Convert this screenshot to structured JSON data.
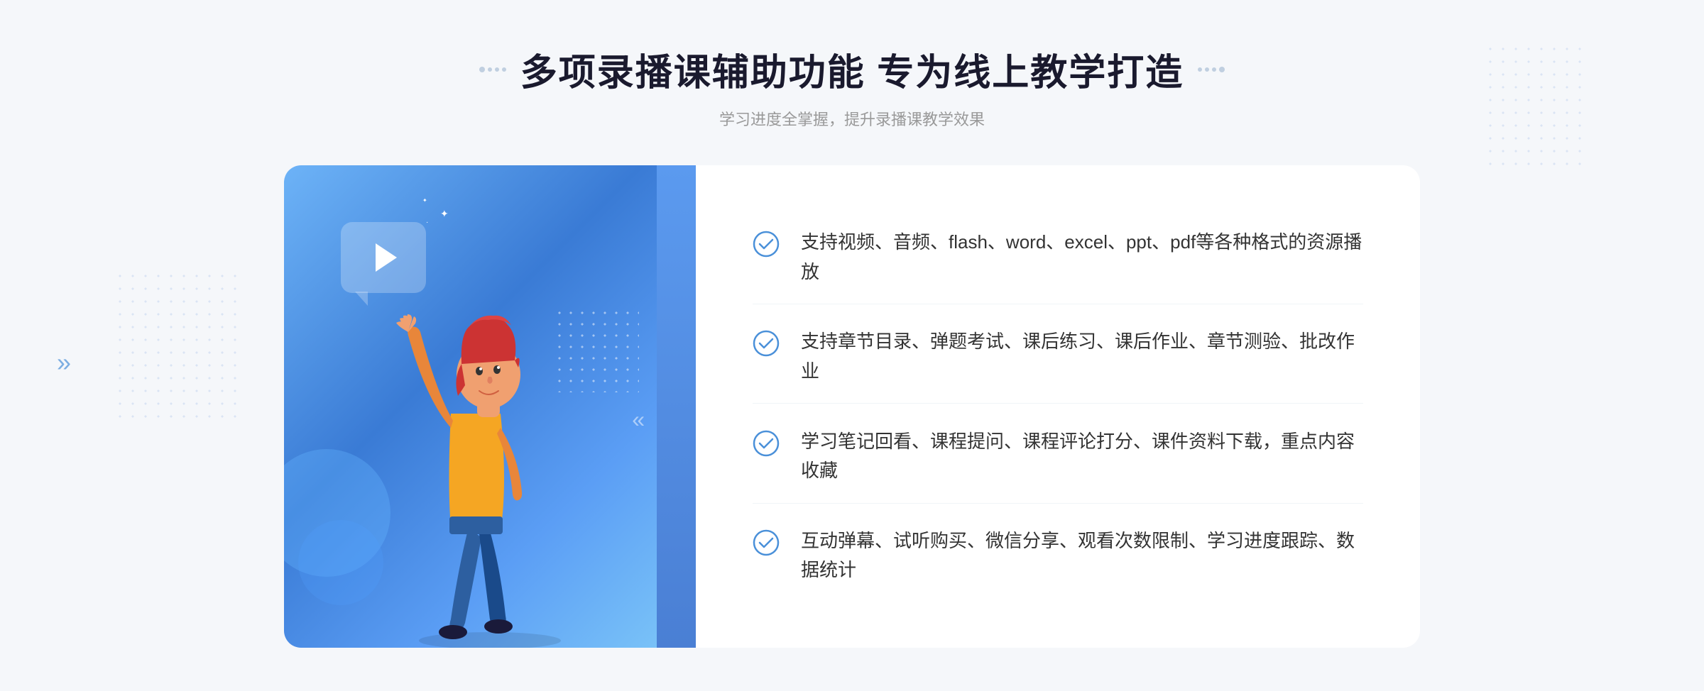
{
  "page": {
    "background_color": "#f5f7fa"
  },
  "header": {
    "main_title": "多项录播课辅助功能 专为线上教学打造",
    "sub_title": "学习进度全掌握，提升录播课教学效果"
  },
  "features": [
    {
      "id": "feature-1",
      "text": "支持视频、音频、flash、word、excel、ppt、pdf等各种格式的资源播放"
    },
    {
      "id": "feature-2",
      "text": "支持章节目录、弹题考试、课后练习、课后作业、章节测验、批改作业"
    },
    {
      "id": "feature-3",
      "text": "学习笔记回看、课程提问、课程评论打分、课件资料下载，重点内容收藏"
    },
    {
      "id": "feature-4",
      "text": "互动弹幕、试听购买、微信分享、观看次数限制、学习进度跟踪、数据统计"
    }
  ],
  "decoration": {
    "check_icon_color": "#4a90d9",
    "chevron_symbol": "»",
    "play_symbol": "▶"
  }
}
